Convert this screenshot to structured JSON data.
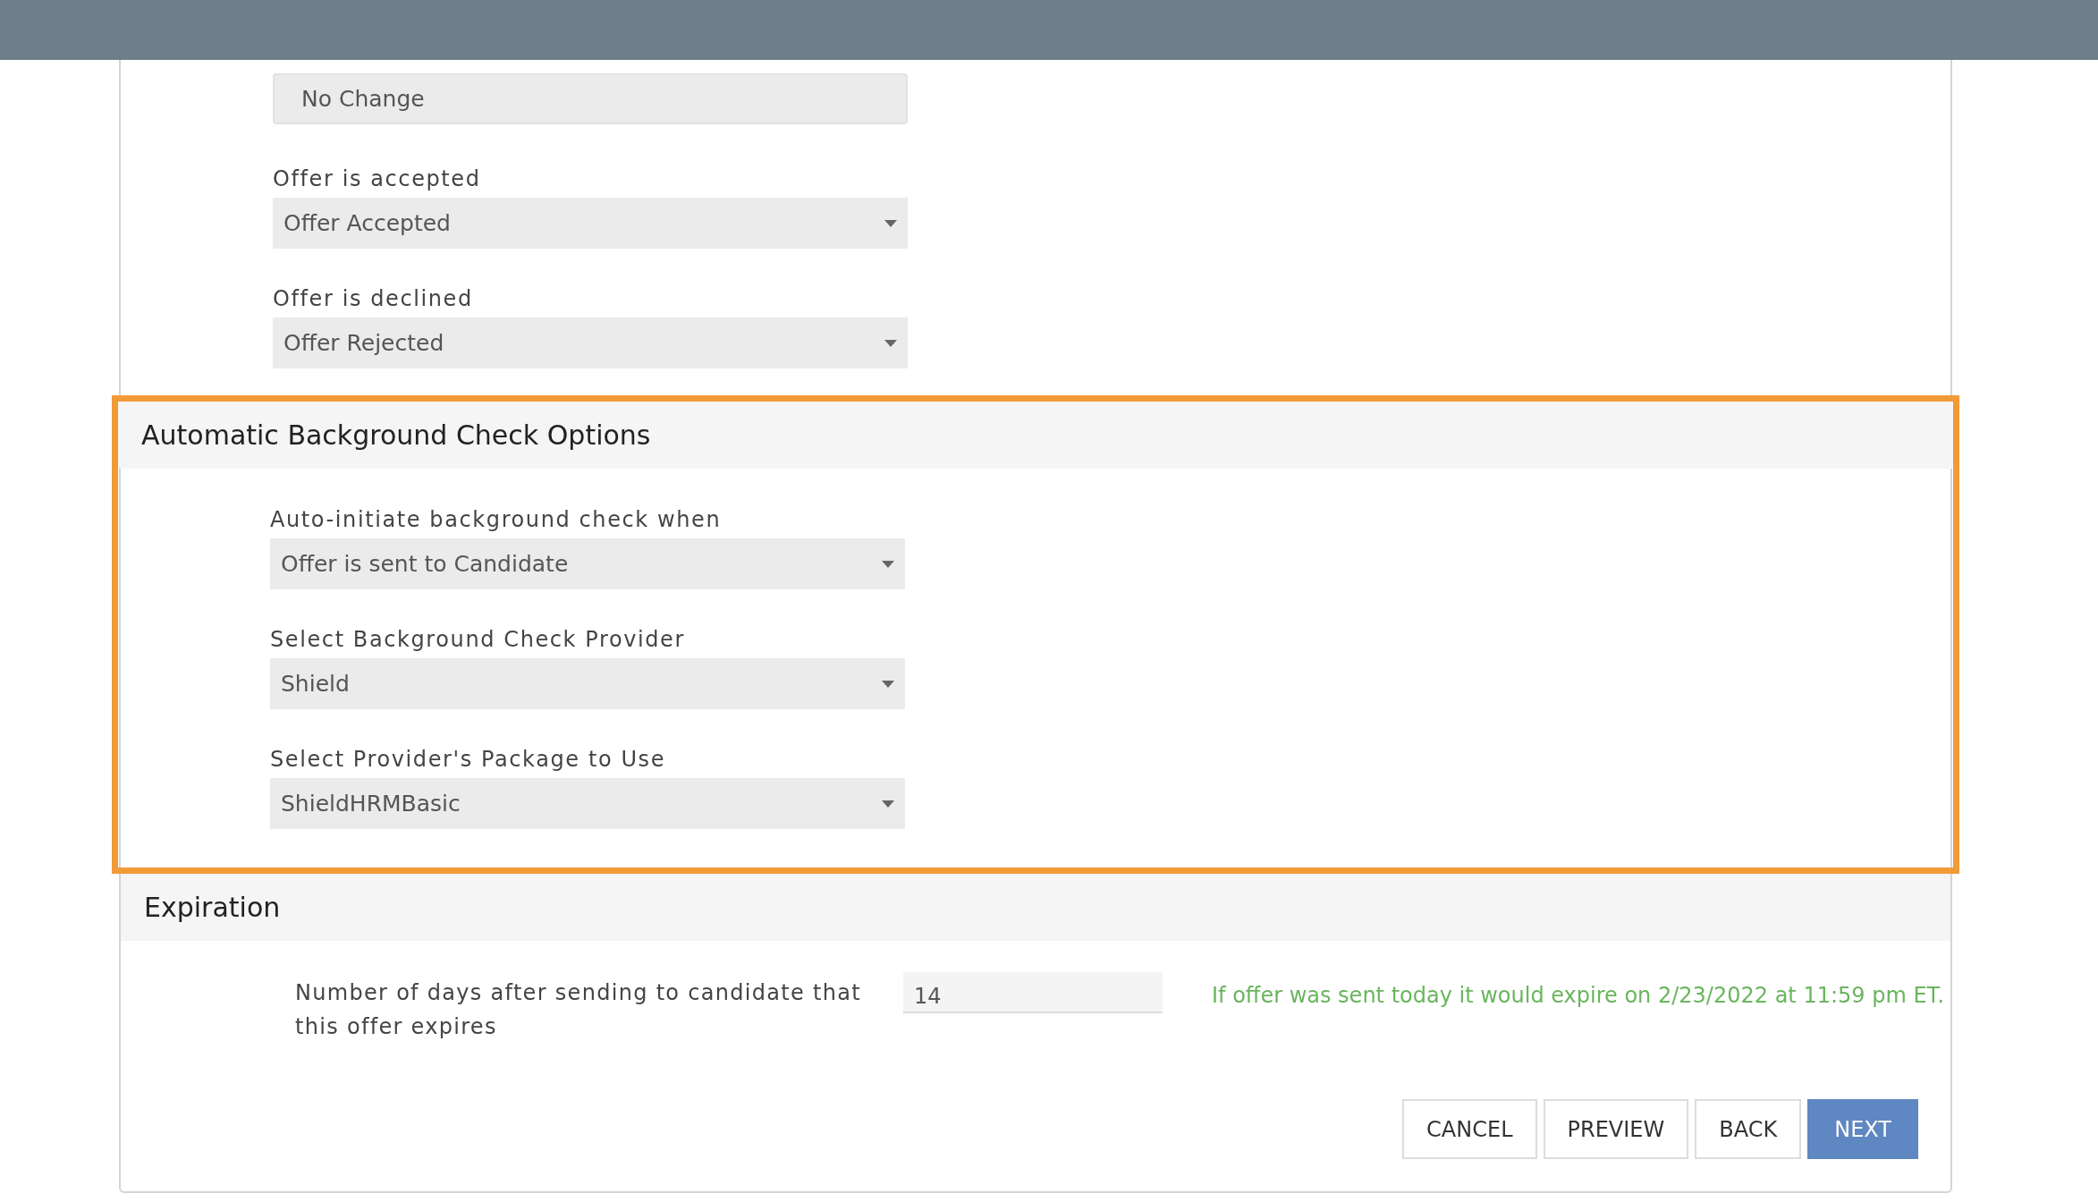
{
  "fields": [
    {
      "kind": "text",
      "value": "No Change"
    },
    {
      "kind": "select",
      "label": "Offer is accepted",
      "value": "Offer Accepted"
    },
    {
      "kind": "select",
      "label": "Offer is declined",
      "value": "Offer Rejected"
    }
  ],
  "sections": [
    {
      "kind": "fields",
      "title": "Automatic Background Check Options",
      "highlighted": true,
      "fields": [
        {
          "kind": "select",
          "label": "Auto-initiate background check when",
          "value": "Offer is sent to Candidate"
        },
        {
          "kind": "select",
          "label": "Select Background Check Provider",
          "value": "Shield"
        },
        {
          "kind": "select",
          "label": "Select Provider's Package to Use",
          "value": "ShieldHRMBasic"
        }
      ]
    },
    {
      "kind": "expiration",
      "title": "Expiration",
      "highlighted": false,
      "label": "Number of days after sending to candidate that this offer expires",
      "value": "14",
      "note": "If offer was sent today it would expire on 2/23/2022 at 11:59 pm ET."
    }
  ],
  "buttons": [
    {
      "label": "CANCEL",
      "primary": false
    },
    {
      "label": "PREVIEW",
      "primary": false
    },
    {
      "label": "BACK",
      "primary": false
    },
    {
      "label": "NEXT",
      "primary": true
    }
  ]
}
